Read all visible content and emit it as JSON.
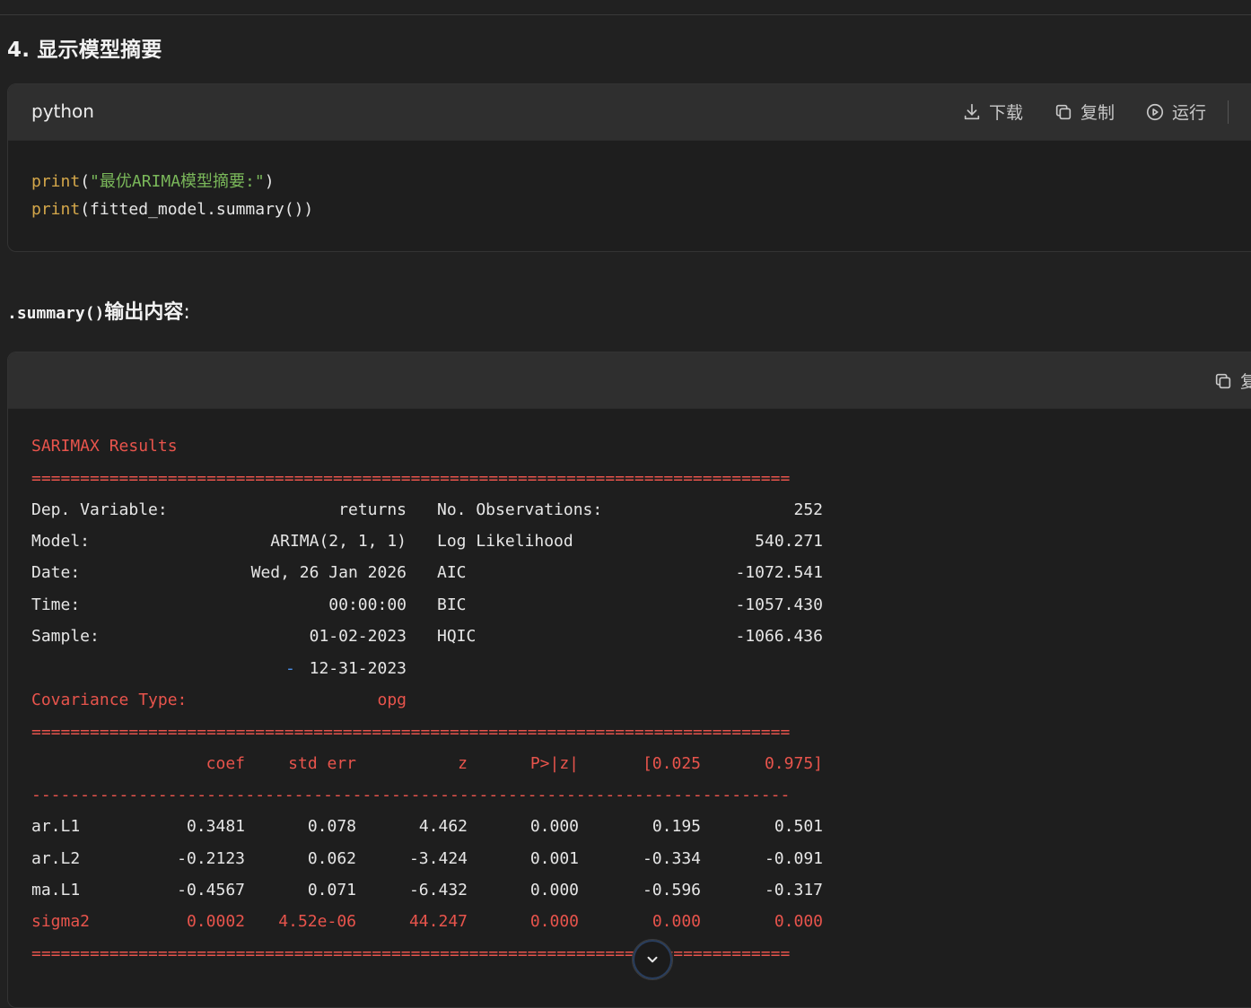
{
  "section": {
    "heading": "4. 显示模型摘要"
  },
  "code_block_1": {
    "language": "python",
    "actions": {
      "download": "下载",
      "copy": "复制",
      "run": "运行"
    },
    "lines": [
      {
        "fn": "print",
        "open": "(",
        "str": "\"最优ARIMA模型摘要:\"",
        "close": ")"
      },
      {
        "fn": "print",
        "rest": "(fitted_model.summary())"
      }
    ]
  },
  "summary_heading": {
    "code": ".summary()",
    "text": "输出内容",
    "colon": ":"
  },
  "code_block_2": {
    "copy_label": "复",
    "title": "SARIMAX Results",
    "rule_double": "==============================================================================",
    "rule_single": "------------------------------------------------------------------------------",
    "info_rows": [
      {
        "label": "Dep. Variable:",
        "value": "returns",
        "label2": "No. Observations:",
        "value2": "252"
      },
      {
        "label": "Model:",
        "value": "ARIMA(2, 1, 1)",
        "label2": "Log Likelihood",
        "value2": "540.271"
      },
      {
        "label": "Date:",
        "value": "Wed, 26 Jan 2026",
        "label2": "AIC",
        "value2": "-1072.541"
      },
      {
        "label": "Time:",
        "value": "00:00:00",
        "label2": "BIC",
        "value2": "-1057.430"
      },
      {
        "label": "Sample:",
        "value": "01-02-2023",
        "label2": "HQIC",
        "value2": "-1066.436"
      },
      {
        "label": "",
        "dash": "-",
        "value": "12-31-2023",
        "label2": "",
        "value2": ""
      }
    ],
    "covariance": {
      "label": "Covariance Type:",
      "value": "opg"
    },
    "columns": [
      "coef",
      "std err",
      "z",
      "P>|z|",
      "[0.025",
      "0.975]"
    ],
    "params": [
      {
        "name": "ar.L1",
        "coef": "0.3481",
        "stderr": "0.078",
        "z": "4.462",
        "p": "0.000",
        "lo": "0.195",
        "hi": "0.501"
      },
      {
        "name": "ar.L2",
        "coef": "-0.2123",
        "stderr": "0.062",
        "z": "-3.424",
        "p": "0.001",
        "lo": "-0.334",
        "hi": "-0.091"
      },
      {
        "name": "ma.L1",
        "coef": "-0.4567",
        "stderr": "0.071",
        "z": "-6.432",
        "p": "0.000",
        "lo": "-0.596",
        "hi": "-0.317"
      },
      {
        "name": "sigma2",
        "coef": "0.0002",
        "stderr": "4.52e-06",
        "z": "44.247",
        "p": "0.000",
        "lo": "0.000",
        "hi": "0.000"
      }
    ]
  },
  "colors": {
    "red": "#e8544c",
    "keyword": "#d4a74a",
    "string": "#7ab85a",
    "background": "#212121"
  }
}
